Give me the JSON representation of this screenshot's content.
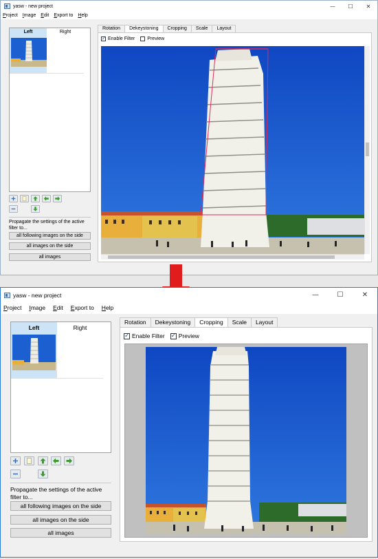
{
  "top": {
    "title": "yasw - new project",
    "controls": {
      "minimize": "—",
      "maximize": "☐",
      "close": "✕"
    },
    "menu": [
      "Project",
      "Image",
      "Edit",
      "Export to",
      "Help"
    ],
    "list_headers": {
      "left": "Left",
      "right": "Right"
    },
    "tabs": [
      "Rotation",
      "Dekeystoning",
      "Cropping",
      "Scale",
      "Layout"
    ],
    "active_tab": "Dekeystoning",
    "enable_filter": {
      "label": "Enable Filter",
      "checked": true
    },
    "preview": {
      "label": "Preview",
      "checked": false
    },
    "propagate_text": "Propagate the settings of the active filter to...",
    "buttons": {
      "following": "all following images on the side",
      "side": "all images on the side",
      "all": "all images"
    }
  },
  "bottom": {
    "title": "yasw - new project",
    "controls": {
      "minimize": "—",
      "maximize": "☐",
      "close": "✕"
    },
    "menu": [
      "Project",
      "Image",
      "Edit",
      "Export to",
      "Help"
    ],
    "list_headers": {
      "left": "Left",
      "right": "Right"
    },
    "tabs": [
      "Rotation",
      "Dekeystoning",
      "Cropping",
      "Scale",
      "Layout"
    ],
    "active_tab": "Cropping",
    "enable_filter": {
      "label": "Enable Filter",
      "checked": true
    },
    "preview": {
      "label": "Preview",
      "checked": true
    },
    "propagate_text": "Propagate the settings of the active filter to...",
    "buttons": {
      "following": "all following images on the side",
      "side": "all images on the side",
      "all": "all images"
    }
  },
  "colors": {
    "arrow": "#e01c1c",
    "sky": "#1c5fd0",
    "selection": "#cde4f7",
    "dekeystone_frame": "#e02a5a"
  },
  "icons": [
    "add-icon",
    "blank-page-icon",
    "arrow-up-icon",
    "arrow-left-icon",
    "arrow-right-icon",
    "remove-icon",
    "arrow-down-icon",
    "down-arrow-icon"
  ]
}
